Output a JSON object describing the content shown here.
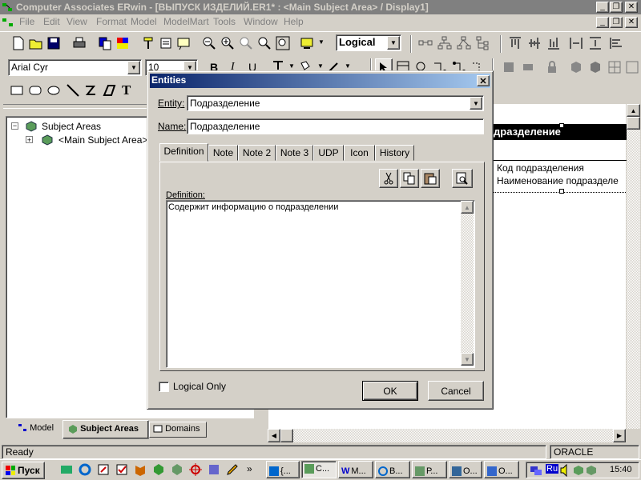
{
  "window": {
    "title": "Computer Associates ERwin - [ВЫПУСК ИЗДЕЛИЙ.ER1* : <Main Subject Area> / Display1]"
  },
  "menu": [
    "File",
    "Edit",
    "View",
    "Format",
    "Model",
    "ModelMart",
    "Tools",
    "Window",
    "Help"
  ],
  "toolbar": {
    "view_level": "Logical",
    "font_name": "Arial Cyr",
    "font_size": "10"
  },
  "tree": {
    "root": "Subject Areas",
    "child": "<Main Subject Area>"
  },
  "left_tabs": [
    "Model",
    "Subject Areas",
    "Domains"
  ],
  "canvas": {
    "entity_title": "дразделение",
    "attributes": [
      "Код подразделения",
      "Наименование подразделе"
    ]
  },
  "dialog": {
    "title": "Entities",
    "entity_label": "Entity:",
    "entity_value": "Подразделение",
    "name_label": "Name:",
    "name_value": "Подразделение",
    "tabs": [
      "Definition",
      "Note",
      "Note 2",
      "Note 3",
      "UDP",
      "Icon",
      "History"
    ],
    "definition_label": "Definition:",
    "definition_text": "Содержит информацию о подразделении",
    "logical_only": "Logical Only",
    "ok": "OK",
    "cancel": "Cancel"
  },
  "status": {
    "left": "Ready",
    "db": "ORACLE"
  },
  "taskbar": {
    "start": "Пуск",
    "tasks": [
      "{...",
      "С...",
      "М...",
      "В...",
      "Р...",
      "О...",
      "О..."
    ],
    "lang": "Ru",
    "time": "15:40"
  }
}
